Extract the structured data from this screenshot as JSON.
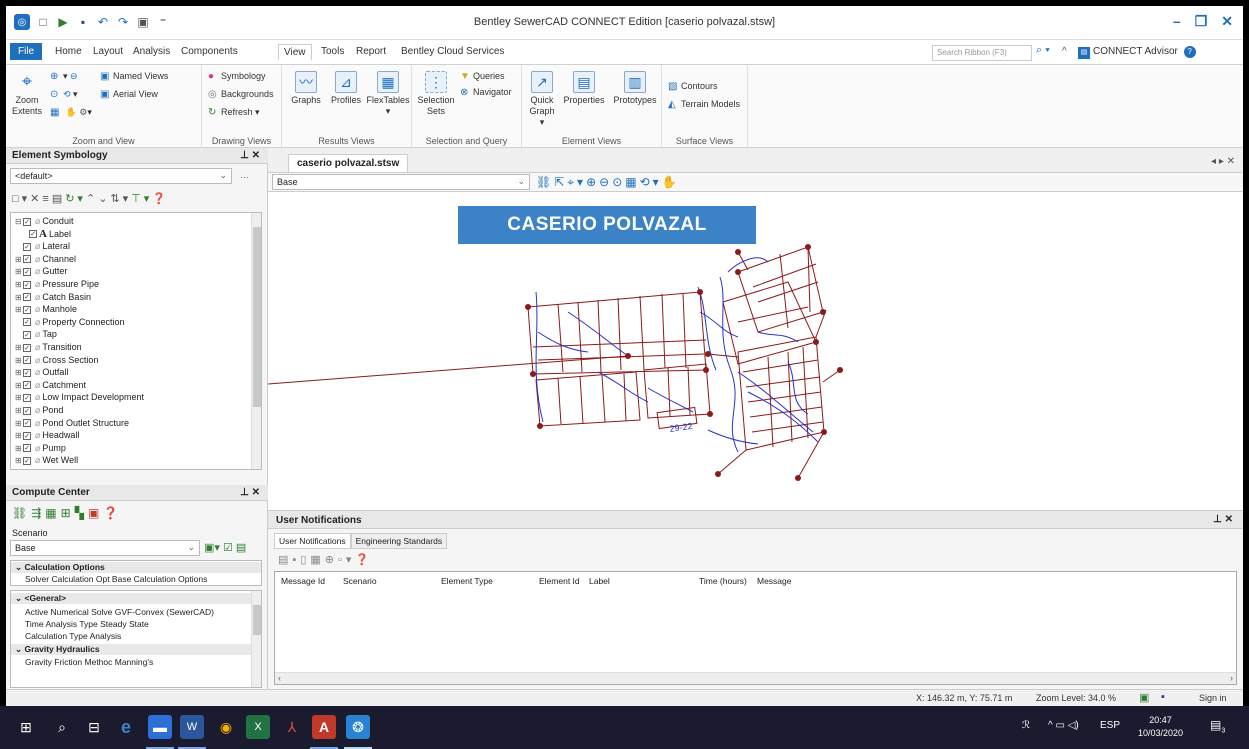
{
  "window": {
    "title": "Bentley SewerCAD CONNECT Edition [caserio polvazal.stsw]"
  },
  "ribbon_tabs": [
    "File",
    "Home",
    "Layout",
    "Analysis",
    "Components",
    "View",
    "Tools",
    "Report",
    "Bentley Cloud Services"
  ],
  "active_tab": "View",
  "search_ribbon": {
    "placeholder": "Search Ribbon (F3)"
  },
  "connect_advisor": "CONNECT Advisor",
  "ribbon_groups": {
    "zoom_and_view": {
      "label": "Zoom and View",
      "zoom_extents": "Zoom Extents",
      "named_views": "Named Views",
      "aerial_view": "Aerial View"
    },
    "drawing_views": {
      "label": "Drawing Views",
      "symbology": "Symbology",
      "backgrounds": "Backgrounds",
      "refresh": "Refresh"
    },
    "results_views": {
      "label": "Results Views",
      "graphs": "Graphs",
      "profiles": "Profiles",
      "flextables": "FlexTables"
    },
    "selection_and_query": {
      "label": "Selection and Query",
      "selection_sets": "Selection Sets",
      "queries": "Queries",
      "navigator": "Navigator"
    },
    "element_views": {
      "label": "Element Views",
      "quick_graph": "Quick Graph",
      "properties": "Properties",
      "prototypes": "Prototypes"
    },
    "surface_views": {
      "label": "Surface Views",
      "contours": "Contours",
      "terrain_models": "Terrain Models"
    }
  },
  "element_symbology": {
    "title": "Element Symbology",
    "dropdown_value": "<default>",
    "tree": [
      {
        "label": "Conduit",
        "exp": "⊟"
      },
      {
        "label": "Label",
        "child": true
      },
      {
        "label": "Lateral",
        "exp": ""
      },
      {
        "label": "Channel",
        "exp": "⊞"
      },
      {
        "label": "Gutter",
        "exp": "⊞"
      },
      {
        "label": "Pressure Pipe",
        "exp": "⊞"
      },
      {
        "label": "Catch Basin",
        "exp": "⊞"
      },
      {
        "label": "Manhole",
        "exp": "⊞"
      },
      {
        "label": "Property Connection",
        "exp": ""
      },
      {
        "label": "Tap",
        "exp": ""
      },
      {
        "label": "Transition",
        "exp": "⊞"
      },
      {
        "label": "Cross Section",
        "exp": "⊞"
      },
      {
        "label": "Outfall",
        "exp": "⊞"
      },
      {
        "label": "Catchment",
        "exp": "⊞"
      },
      {
        "label": "Low Impact Development",
        "exp": "⊞"
      },
      {
        "label": "Pond",
        "exp": "⊞"
      },
      {
        "label": "Pond Outlet Structure",
        "exp": "⊞"
      },
      {
        "label": "Headwall",
        "exp": "⊞"
      },
      {
        "label": "Pump",
        "exp": "⊞"
      },
      {
        "label": "Wet Well",
        "exp": "⊞"
      }
    ]
  },
  "compute_center": {
    "title": "Compute Center",
    "scenario_label": "Scenario",
    "scenario_value": "Base",
    "calc_options_header": "Calculation Options",
    "calc_options_row": "Solver Calculation Opt Base Calculation Options",
    "general_header": "<General>",
    "rows": [
      "Active Numerical Solve GVF-Convex (SewerCAD)",
      "Time Analysis Type    Steady State",
      "Calculation Type        Analysis"
    ],
    "gravity_header": "Gravity Hydraulics",
    "gravity_row": "Gravity Friction Methoc Manning's"
  },
  "document": {
    "tab_label": "caserio polvazal.stsw",
    "view_dropdown": "Base",
    "banner_text": "CASERIO POLVAZAL",
    "drawing_label": "29-22"
  },
  "notifications": {
    "title": "User Notifications",
    "tabs": [
      "User Notifications",
      "Engineering Standards"
    ],
    "columns": [
      "Message Id",
      "Scenario",
      "Element Type",
      "Element Id",
      "Label",
      "Time (hours)",
      "Message"
    ]
  },
  "statusbar": {
    "coords": "X: 146.32 m, Y: 75.71 m",
    "zoom": "Zoom Level: 34.0 %",
    "sign_in": "Sign in"
  },
  "taskbar": {
    "language": "ESP",
    "time": "20:47",
    "date": "10/03/2020",
    "notification_count": "3"
  },
  "colors": {
    "accent": "#1f6fbf",
    "banner": "#3b83c6",
    "network_red": "#8b1a1a",
    "network_blue": "#2633c9"
  }
}
